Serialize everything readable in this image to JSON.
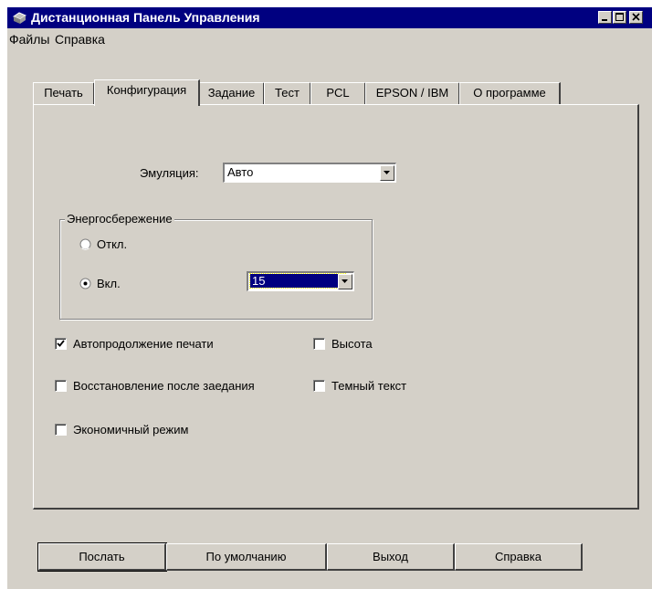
{
  "window": {
    "title": "Дистанционная Панель Управления"
  },
  "menu": {
    "items": [
      "Файлы",
      "Справка"
    ]
  },
  "tabs": [
    "Печать",
    "Конфигурация",
    "Задание",
    "Тест",
    "PCL",
    "EPSON / IBM",
    "О программе"
  ],
  "active_tab": "Конфигурация",
  "emulation": {
    "label": "Эмуляция:",
    "value": "Авто"
  },
  "power_saving": {
    "title": "Энергосбережение",
    "options": [
      {
        "label": "Откл.",
        "selected": false
      },
      {
        "label": "Вкл.",
        "selected": true
      }
    ],
    "timeout_value": "15"
  },
  "checkboxes": {
    "auto_continue": {
      "label": "Автопродолжение печати",
      "checked": true
    },
    "jam_recovery": {
      "label": "Восстановление после заедания",
      "checked": false
    },
    "economy_mode": {
      "label": "Экономичный режим",
      "checked": false
    },
    "altitude": {
      "label": "Высота",
      "checked": false
    },
    "dark_text": {
      "label": "Темный текст",
      "checked": false
    }
  },
  "buttons": {
    "send": "Послать",
    "defaults": "По умолчанию",
    "exit": "Выход",
    "help": "Справка"
  },
  "colors": {
    "titlebar": "#000080",
    "face": "#d4d0c8",
    "selection": "#000080"
  }
}
